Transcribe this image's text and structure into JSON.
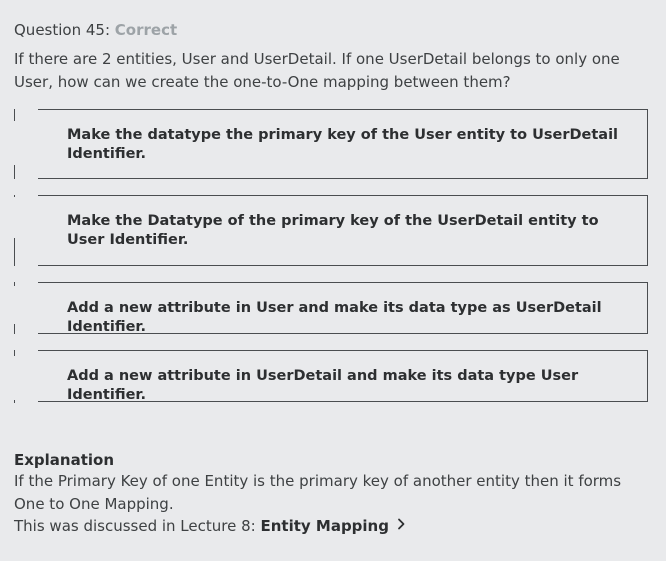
{
  "question": {
    "number_label": "Question 45:",
    "status": "Correct",
    "text": "If there are 2 entities, User and UserDetail. If one UserDetail belongs to only one User, how can we create the one-to-One mapping between them?"
  },
  "options": [
    {
      "label": "Make the datatype the primary key of the User entity to UserDetail Identifier."
    },
    {
      "label": "Make the Datatype of the primary key of the UserDetail entity to User Identifier."
    },
    {
      "label": "Add a new attribute in User and make its data type as UserDetail Identifier."
    },
    {
      "label": "Add a new attribute in UserDetail and make its data type User Identifier."
    }
  ],
  "explanation": {
    "heading": "Explanation",
    "text": "If the Primary Key of one Entity is the primary key of another entity then it forms One to One Mapping.",
    "lecture_prefix": "This was discussed in Lecture 8:",
    "lecture_link": "Entity Mapping",
    "link_icon": "chevron-right-icon"
  },
  "colors": {
    "background": "#e9eaec",
    "status_correct": "#9da3a7",
    "border": "#4a4d50",
    "text": "#2d2f31"
  }
}
